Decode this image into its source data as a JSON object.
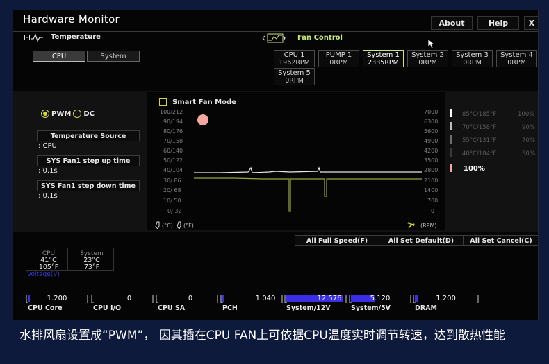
{
  "app_title": "Hardware Monitor",
  "top_buttons": {
    "about": "About",
    "help": "Help",
    "close": "X"
  },
  "temperature_section": {
    "title": "Temperature",
    "tabs": [
      "CPU",
      "System"
    ],
    "active_tab": "CPU"
  },
  "fan_control_section": {
    "title": "Fan Control"
  },
  "fans": [
    {
      "name": "CPU 1",
      "rpm": "1962RPM"
    },
    {
      "name": "PUMP 1",
      "rpm": "0RPM"
    },
    {
      "name": "System 1",
      "rpm": "2335RPM"
    },
    {
      "name": "System 2",
      "rpm": "0RPM"
    },
    {
      "name": "System 3",
      "rpm": "0RPM"
    },
    {
      "name": "System 4",
      "rpm": "0RPM"
    },
    {
      "name": "System 5",
      "rpm": "0RPM"
    }
  ],
  "active_fan": "System 1",
  "mode": {
    "pwm": "PWM",
    "dc": "DC",
    "selected": "PWM"
  },
  "settings": {
    "temperature_source_label": "Temperature Source",
    "temperature_source_value": ": CPU",
    "step_up_label": "SYS Fan1 step up time",
    "step_up_value": ": 0.1s",
    "step_down_label": "SYS Fan1 step down time",
    "step_down_value": ": 0.1s"
  },
  "smart_fan_mode": {
    "label": "Smart Fan Mode",
    "checked": false
  },
  "temp_scale": [
    "100/212",
    "90/194",
    "80/176",
    "70/158",
    "60/140",
    "50/122",
    "40/104",
    "30/ 86",
    "20/ 68",
    "10/ 50",
    "0/ 32"
  ],
  "rpm_scale": [
    "7000",
    "6300",
    "5600",
    "4900",
    "4200",
    "3500",
    "2800",
    "2100",
    "1400",
    "700",
    "0"
  ],
  "unit_labels": {
    "celsius": "(°C)",
    "fahrenheit": "(°F)",
    "rpm": "(RPM)"
  },
  "fan_steps": [
    {
      "temp": "85°C/185°F",
      "percent": "100%"
    },
    {
      "temp": "70°C/158°F",
      "percent": "90%"
    },
    {
      "temp": "55°C/131°F",
      "percent": "70%"
    },
    {
      "temp": "40°C/104°F",
      "percent": "50%"
    }
  ],
  "current_percent": "100%",
  "actions": {
    "full_speed": "All Full Speed(F)",
    "set_default": "All Set Default(D)",
    "set_cancel": "All Set Cancel(C)"
  },
  "readings": {
    "cpu": {
      "label": "CPU",
      "celsius": "41°C",
      "fahrenheit": "105°F"
    },
    "system": {
      "label": "System",
      "celsius": "23°C",
      "fahrenheit": "73°F"
    }
  },
  "voltage_label": "Voltage(V)",
  "voltages": [
    {
      "name": "CPU Core",
      "value": "1.200",
      "fill": 0.04
    },
    {
      "name": "CPU I/O",
      "value": "0",
      "fill": 0.0
    },
    {
      "name": "CPU SA",
      "value": "0",
      "fill": 0.0
    },
    {
      "name": "PCH",
      "value": "1.040",
      "fill": 0.04
    },
    {
      "name": "System/12V",
      "value": "12.576",
      "fill": 0.95
    },
    {
      "name": "System/5V",
      "value": "5.120",
      "fill": 0.4
    },
    {
      "name": "DRAM",
      "value": "1.200",
      "fill": 0.04
    }
  ],
  "caption": "水排风扇设置成“PWM”， 因其插在CPU FAN上可依据CPU温度实时调节转速，达到散热性能",
  "colors": {
    "accent_green": "#c9e87a",
    "voltage_fill": "#3a2ee6",
    "graph_white": "#e8e8e8",
    "graph_yellow": "#9aa63c",
    "pink_dot": "#f5a8a0"
  }
}
